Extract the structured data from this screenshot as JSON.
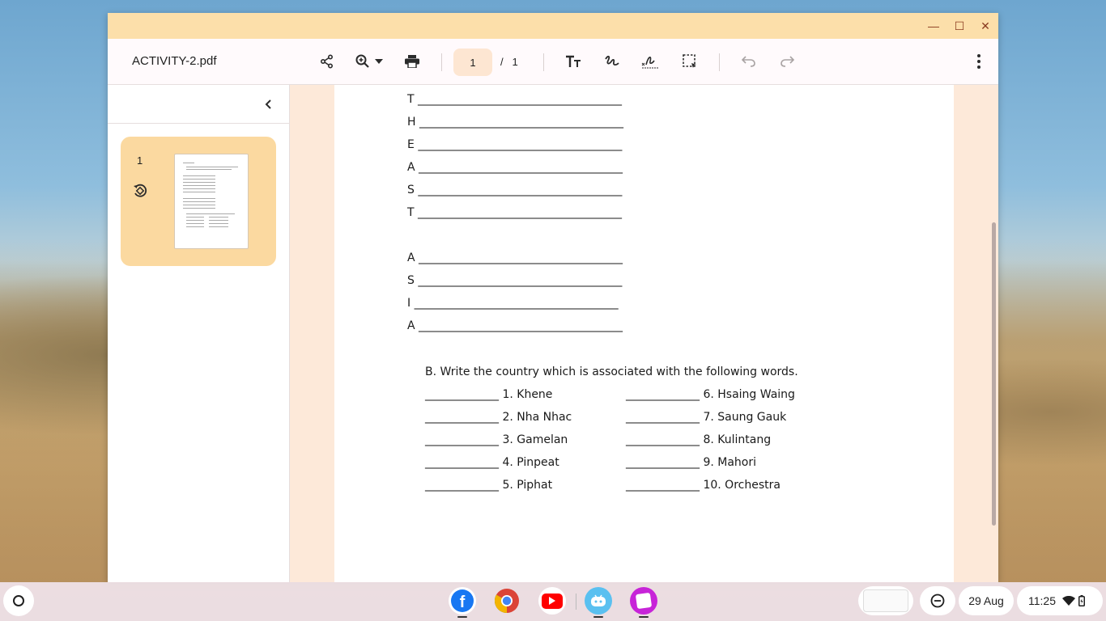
{
  "window": {
    "file_name": "ACTIVITY-2.pdf",
    "controls": {
      "minimize": "—",
      "maximize": "☐",
      "close": "✕"
    }
  },
  "toolbar": {
    "page_current": "1",
    "page_separator": "/",
    "page_total": "1"
  },
  "sidebar": {
    "thumbnail_page_number": "1"
  },
  "document": {
    "acrostic_1": [
      "T",
      "H",
      "E",
      "A",
      "S",
      "T"
    ],
    "acrostic_2": [
      "A",
      "S",
      "I",
      "A"
    ],
    "blank": "____________________________________",
    "section_b_title": "B.  Write the country which is associated with the following words.",
    "short_blank": "_____________",
    "items_left": [
      "1. Khene",
      "2. Nha Nhac",
      "3. Gamelan",
      "4. Pinpeat",
      "5. Piphat"
    ],
    "items_right": [
      "6. Hsaing Waing",
      "7. Saung Gauk",
      "8. Kulintang",
      "9. Mahori",
      "10. Orchestra"
    ]
  },
  "shelf": {
    "apps": [
      "facebook-icon",
      "chrome-icon",
      "youtube-icon",
      "assistant-icon",
      "notes-icon"
    ],
    "date": "29 Aug",
    "time": "11:25"
  },
  "colors": {
    "titlebar": "#fcdfaa",
    "viewer_bg": "#fde9d9",
    "thumb_card": "#fbd9a0"
  }
}
